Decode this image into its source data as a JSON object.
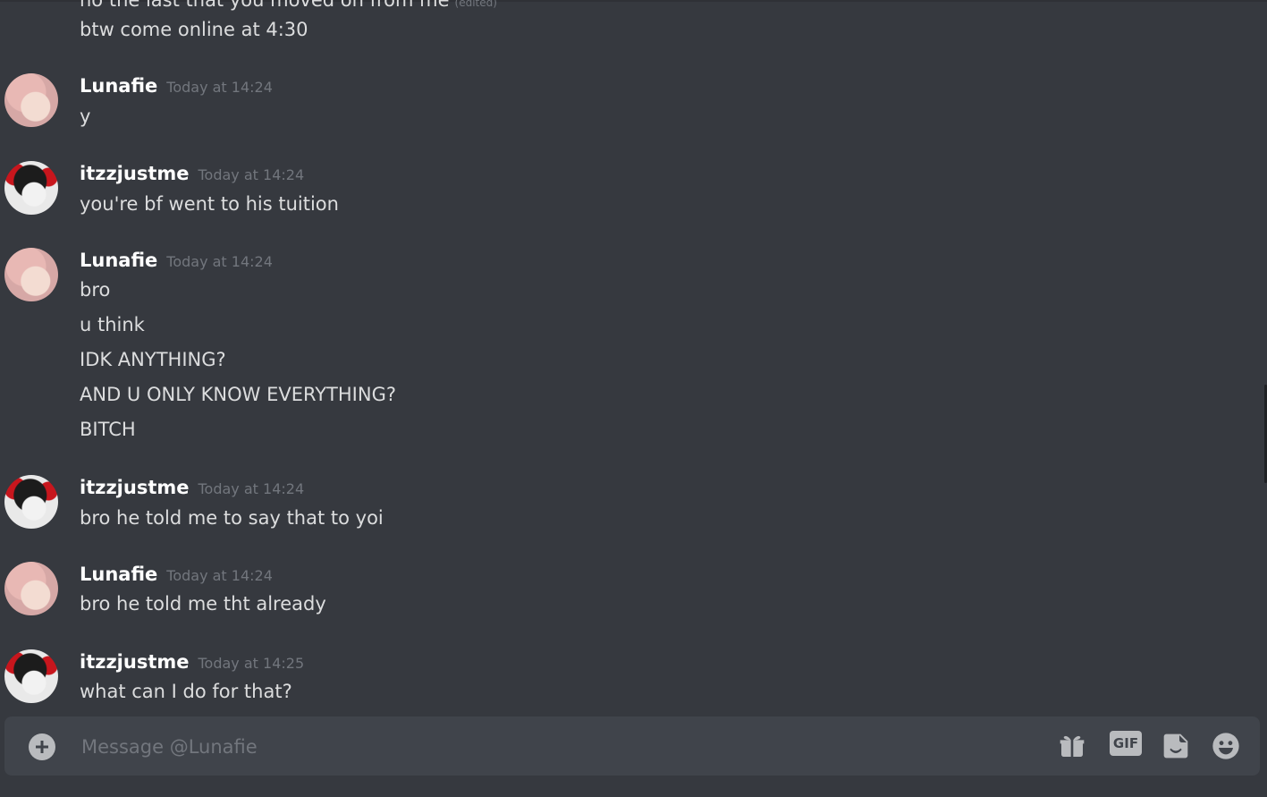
{
  "cutoff_message": {
    "text": "no the last that you moved on from me",
    "edited": "(edited)"
  },
  "first_line": "btw come online at 4:30",
  "messages": [
    {
      "author": "Lunafie",
      "timestamp": "Today at 14:24",
      "lines": [
        "y"
      ]
    },
    {
      "author": "itzzjustme",
      "timestamp": "Today at 14:24",
      "lines": [
        "you're bf went to his tuition"
      ]
    },
    {
      "author": "Lunafie",
      "timestamp": "Today at 14:24",
      "lines": [
        "bro",
        "u think",
        "IDK ANYTHING?",
        "AND U ONLY KNOW EVERYTHING?",
        "BITCH"
      ]
    },
    {
      "author": "itzzjustme",
      "timestamp": "Today at 14:24",
      "lines": [
        "bro he told me to say that to yoi"
      ]
    },
    {
      "author": "Lunafie",
      "timestamp": "Today at 14:24",
      "lines": [
        "bro he told me tht already"
      ]
    },
    {
      "author": "itzzjustme",
      "timestamp": "Today at 14:25",
      "lines": [
        "what can I do for that?"
      ]
    }
  ],
  "composer": {
    "placeholder": "Message @Lunafie",
    "gif_label": "GIF",
    "icons": [
      "plus-circle-icon",
      "gift-icon",
      "gif-icon",
      "sticker-icon",
      "emoji-icon"
    ]
  },
  "colors": {
    "background": "#36393f",
    "composer": "#40444b",
    "username": "#ffffff",
    "text": "#dcddde",
    "muted": "#72767d"
  }
}
